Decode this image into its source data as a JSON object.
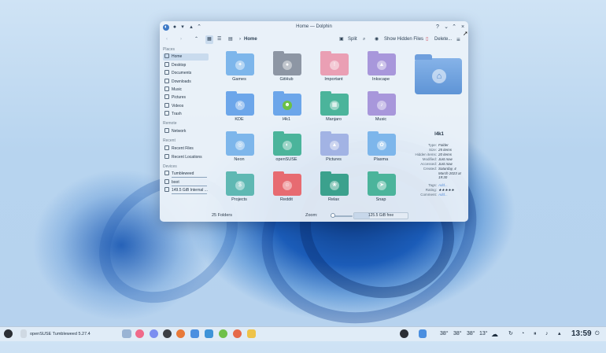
{
  "window": {
    "title": "Home — Dolphin",
    "controls": {
      "help": "?",
      "minimize": "⌄",
      "maximize": "⌃",
      "close": "×"
    }
  },
  "toolbar": {
    "breadcrumb": "Home",
    "split_label": "Split",
    "show_hidden_label": "Show Hidden Files",
    "delete_label": "Delete..."
  },
  "sidebar": {
    "sections": [
      {
        "title": "Places",
        "items": [
          "Home",
          "Desktop",
          "Documents",
          "Downloads",
          "Music",
          "Pictures",
          "Videos",
          "Trash"
        ]
      },
      {
        "title": "Remote",
        "items": [
          "Network"
        ]
      },
      {
        "title": "Recent",
        "items": [
          "Recent Files",
          "Recent Locations"
        ]
      },
      {
        "title": "Devices",
        "items": [
          "Tumbleweed",
          "boot",
          "149.5 GiB Internal ..."
        ]
      }
    ],
    "selected": "Home"
  },
  "folders": [
    {
      "name": "Games",
      "color": "#7fb6e8",
      "icon": "gamepad-icon"
    },
    {
      "name": "GitHub",
      "color": "#8d96a3",
      "icon": "github-icon"
    },
    {
      "name": "Important",
      "color": "#e7a0b4",
      "icon": "exclamation-icon"
    },
    {
      "name": "Inkscape",
      "color": "#a897d8",
      "icon": "inkscape-icon"
    },
    {
      "name": "KDE",
      "color": "#6ea6e6",
      "icon": "kde-icon"
    },
    {
      "name": "l4k1",
      "color": "#6ea6e6",
      "icon": "chameleon-icon"
    },
    {
      "name": "Manjaro",
      "color": "#4fb39b",
      "icon": "manjaro-icon"
    },
    {
      "name": "Music",
      "color": "#a897d8",
      "icon": "music-note-icon"
    },
    {
      "name": "Neon",
      "color": "#7fb6e8",
      "icon": "neon-icon"
    },
    {
      "name": "openSUSE",
      "color": "#4fb39b",
      "icon": "opensuse-icon"
    },
    {
      "name": "Pictures",
      "color": "#a3b3e2",
      "icon": "picture-icon"
    },
    {
      "name": "Plasma",
      "color": "#7fb6e8",
      "icon": "plasma-icon"
    },
    {
      "name": "Projects",
      "color": "#62b7b2",
      "icon": "dollar-icon"
    },
    {
      "name": "Reddit",
      "color": "#e26c72",
      "icon": "reddit-icon"
    },
    {
      "name": "Relax",
      "color": "#3fa08d",
      "icon": "lotus-icon"
    },
    {
      "name": "Snap",
      "color": "#4fb39b",
      "icon": "snap-icon"
    }
  ],
  "preview": {
    "name": "l4k1",
    "rows": [
      {
        "key": "Type:",
        "value": "Folder"
      },
      {
        "key": "Size:",
        "value": "25 items"
      },
      {
        "key": "Hidden items:",
        "value": "20 items"
      },
      {
        "key": "Modified:",
        "value": "Just now"
      },
      {
        "key": "Accessed:",
        "value": "Just now"
      },
      {
        "key": "Created:",
        "value": "Saturday, 4 March 2023 at 19:30"
      },
      {
        "key": "Tags:",
        "value": "Add..."
      },
      {
        "key": "Rating:",
        "value": "★★★★★"
      },
      {
        "key": "Comment:",
        "value": "Add..."
      }
    ]
  },
  "status": {
    "count": "25 Folders",
    "zoom_label": "Zoom:",
    "zoom_level": 0.1,
    "free_space": "125.5 GiB free",
    "free_fraction": 0.3
  },
  "taskbar": {
    "active_window": "openSUSE Tumbleweed 5.27.4",
    "weather": [
      "38°",
      "38°",
      "38°",
      "13°"
    ],
    "clock": "13:59"
  },
  "colors": {
    "window_bg": "#ecf2f9",
    "accent": "#5e94d6",
    "selection": "#c9dbee"
  }
}
